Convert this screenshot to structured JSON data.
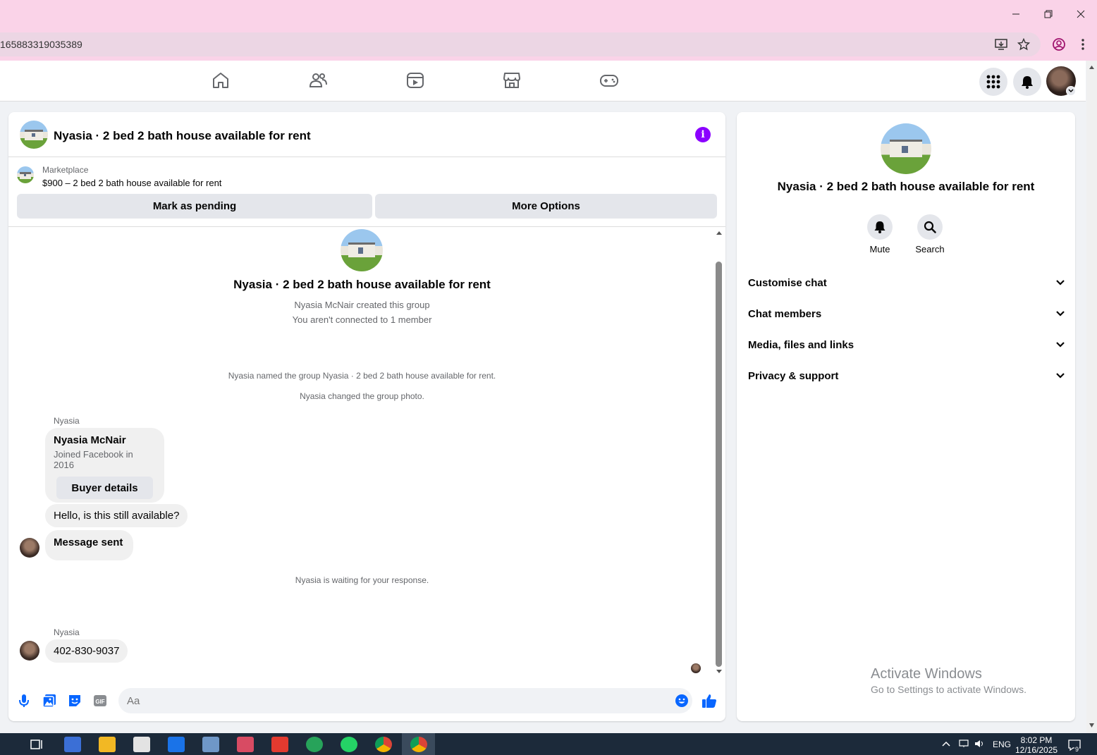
{
  "browser": {
    "url": "165883319035389"
  },
  "colors": {
    "accent": "#8b00ff",
    "fb_blue": "#0866ff",
    "titlebar": "#fad3e8"
  },
  "nav": {
    "icons": [
      "home-icon",
      "friends-icon",
      "video-icon",
      "marketplace-icon",
      "gaming-icon"
    ]
  },
  "chat": {
    "title": "Nyasia · 2 bed 2 bath house available for rent",
    "marketplace_label": "Marketplace",
    "listing": "$900 – 2 bed 2 bath house available for rent",
    "mark_pending": "Mark as pending",
    "more_options": "More Options",
    "group_name": "Nyasia · 2 bed 2 bath house available for rent",
    "created_by": "Nyasia McNair created this group",
    "not_connected": "You aren't connected to 1 member",
    "sys_named": "Nyasia named the group Nyasia · 2 bed 2 bath house available for rent.",
    "sys_photo": "Nyasia changed the group photo.",
    "sender1": "Nyasia",
    "card_name": "Nyasia McNair",
    "card_joined": "Joined Facebook in 2016",
    "buyer_details": "Buyer details",
    "msg1": "Hello, is this still available?",
    "msg2": "Message sent",
    "waiting": "Nyasia is waiting for your response.",
    "sender2": "Nyasia",
    "msg3": "402-830-9037",
    "input_placeholder": "Aa"
  },
  "info": {
    "title": "Nyasia · 2 bed 2 bath house available for rent",
    "mute": "Mute",
    "search": "Search",
    "sections": [
      "Customise chat",
      "Chat members",
      "Media, files and links",
      "Privacy & support"
    ],
    "watermark_title": "Activate Windows",
    "watermark_sub": "Go to Settings to activate Windows."
  },
  "taskbar": {
    "language": "ENG",
    "time": "8:02 PM",
    "date": "12/16/2025",
    "notif_count": "9"
  }
}
